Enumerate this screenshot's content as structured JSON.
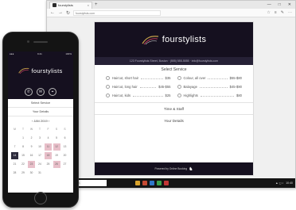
{
  "browser": {
    "tab_title": "fourstylists",
    "tab_close": "×",
    "new_tab": "+",
    "window_controls": [
      "—",
      "□",
      "✕"
    ],
    "nav_icons": [
      "←",
      "→",
      "↻"
    ],
    "url": "fourstylists.com",
    "toolbar_icons": [
      "☆",
      "≡",
      "✎",
      "⋯"
    ]
  },
  "site": {
    "brand": "fourstylists",
    "address_line": "123 Fourstylists Street, Boston · (555) 555-5555 · info@fourstylists.com",
    "section_title": "Select Service",
    "services": [
      {
        "name": "Haircut, short hair",
        "price": "$35"
      },
      {
        "name": "Colour, all over",
        "price": "$55-$80"
      },
      {
        "name": "Haircut, long hair",
        "price": "$45-$55"
      },
      {
        "name": "Balayage",
        "price": "$45-$90"
      },
      {
        "name": "Haircut, kids",
        "price": "$25"
      },
      {
        "name": "Highlights",
        "price": "$80"
      }
    ],
    "time_row": "Time & Staff",
    "details_row": "Your Details",
    "footer_text": "Powered by Online Booking",
    "footer_mark": "♞"
  },
  "taskbar": {
    "search_placeholder": "Type here to search",
    "time": "10:40",
    "tray": "▲ ◻ ♪"
  },
  "app_colors": [
    "#d9a32c",
    "#c64a33",
    "#2f77c9",
    "#3aa24c",
    "#c23535"
  ],
  "phone": {
    "status_left": "●●●",
    "status_time": "9:41",
    "status_right": "100%",
    "brand": "fourstylists",
    "icons": [
      "✆",
      "✉",
      "⌖"
    ],
    "service_label": "Select Service",
    "staff_label": "Your Details",
    "calendar": {
      "month": "‹ JAN 2019 ›",
      "weekdays": [
        "M",
        "T",
        "W",
        "T",
        "F",
        "S",
        "S"
      ],
      "days": [
        "",
        "1",
        "2",
        "3",
        "4",
        "5",
        "6",
        "7",
        "8",
        "9",
        "10",
        "11",
        "12",
        "13",
        "14",
        "15",
        "16",
        "17",
        "18",
        "19",
        "20",
        "21",
        "22",
        "23",
        "24",
        "25",
        "26",
        "27",
        "28",
        "29",
        "30",
        "31",
        "",
        "",
        ""
      ],
      "states": [
        "",
        "",
        "",
        "",
        "",
        "",
        "",
        "",
        "",
        "",
        "",
        "pink",
        "pink",
        "",
        "sel",
        "",
        "",
        "",
        "pink",
        "",
        "",
        "",
        "",
        "pink",
        "",
        "",
        "pink",
        "",
        "",
        "",
        "",
        "",
        "",
        "",
        ""
      ]
    }
  }
}
